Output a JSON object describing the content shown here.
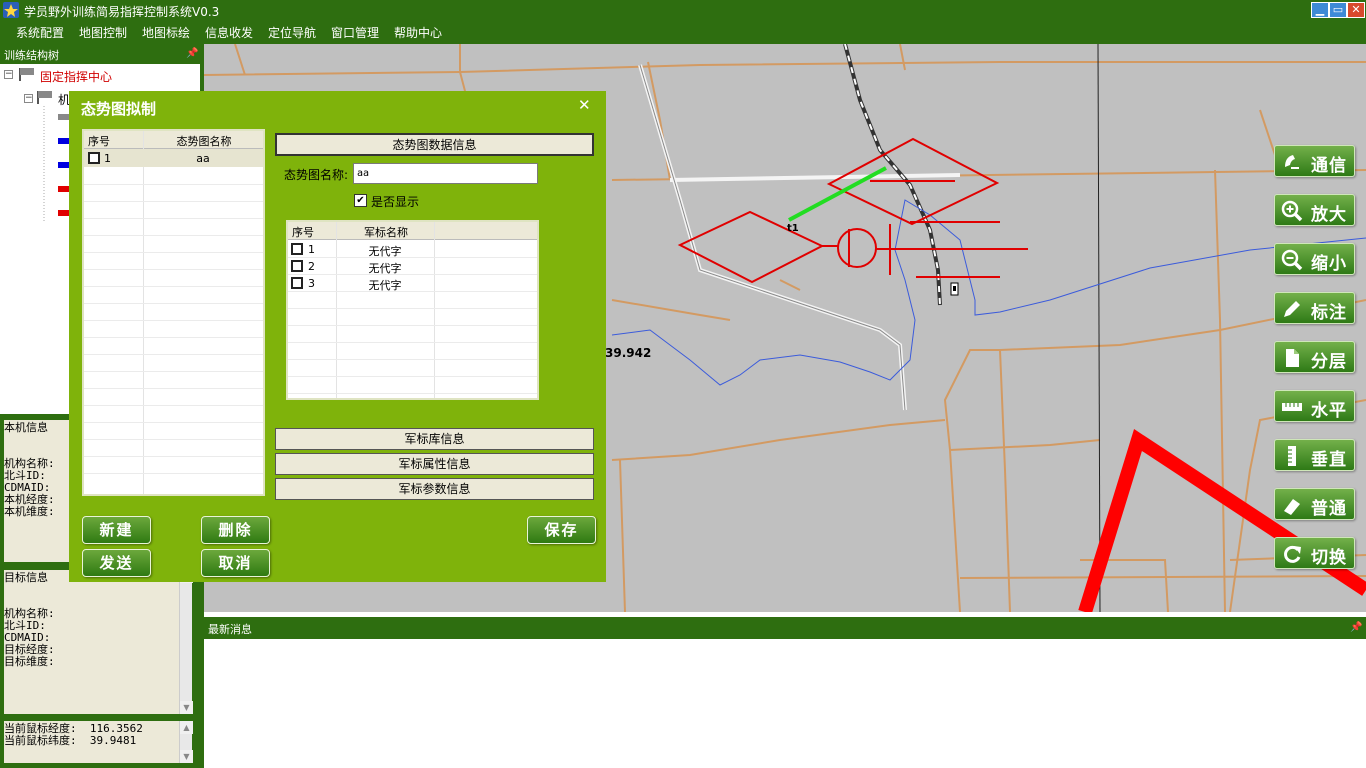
{
  "app": {
    "title": "学员野外训练简易指挥控制系统V0.3"
  },
  "window_buttons": [
    "▁",
    "▭",
    "✕"
  ],
  "menu": [
    "系统配置",
    "地图控制",
    "地图标绘",
    "信息收发",
    "定位导航",
    "窗口管理",
    "帮助中心"
  ],
  "tree_panel": {
    "title": "训练结构树",
    "root": "固定指挥中心",
    "child": "机"
  },
  "local_info": {
    "title": "本机信息",
    "lines": [
      "机构名称:",
      "北斗ID:",
      "CDMAID:",
      "本机经度:",
      "本机维度:"
    ]
  },
  "target_info": {
    "title": "目标信息",
    "lines": [
      "机构名称:",
      "北斗ID:",
      "CDMAID:",
      "目标经度:",
      "目标维度:"
    ]
  },
  "cursor": {
    "lon_label": "当前鼠标经度:",
    "lon": "116.3562",
    "lat_label": "当前鼠标纬度:",
    "lat": "39.9481"
  },
  "map": {
    "coord_label": "39.942",
    "marker_label": "t1",
    "colors": {
      "bg": "#c0c0c0",
      "road": "#d39a62",
      "route": "#ff0000",
      "water": "#3b5bdb",
      "plot": "#e00000",
      "line": "#22dd22"
    }
  },
  "messages": {
    "title": "最新消息"
  },
  "tools": [
    {
      "icon": "comms-icon",
      "label": "通信"
    },
    {
      "icon": "zoom-in-icon",
      "label": "放大"
    },
    {
      "icon": "zoom-out-icon",
      "label": "缩小"
    },
    {
      "icon": "pencil-icon",
      "label": "标注"
    },
    {
      "icon": "layers-icon",
      "label": "分层"
    },
    {
      "icon": "ruler-horizontal-icon",
      "label": "水平"
    },
    {
      "icon": "ruler-vertical-icon",
      "label": "垂直"
    },
    {
      "icon": "eraser-icon",
      "label": "普通"
    },
    {
      "icon": "refresh-icon",
      "label": "切换"
    }
  ],
  "dialog": {
    "title": "态势图拟制",
    "close": "✕",
    "list": {
      "headers": [
        "序号",
        "态势图名称"
      ],
      "rows": [
        {
          "no": "1",
          "name": "aa"
        }
      ]
    },
    "data_info_title": "态势图数据信息",
    "name_label": "态势图名称:",
    "name_value": "aa",
    "show_label": "是否显示",
    "symbols": {
      "headers": [
        "序号",
        "军标名称"
      ],
      "rows": [
        {
          "no": "1",
          "name": "无代字"
        },
        {
          "no": "2",
          "name": "无代字"
        },
        {
          "no": "3",
          "name": "无代字"
        }
      ]
    },
    "sections": [
      "军标库信息",
      "军标属性信息",
      "军标参数信息"
    ],
    "buttons": {
      "new": "新建",
      "delete": "删除",
      "save": "保存",
      "send": "发送",
      "cancel": "取消"
    }
  }
}
